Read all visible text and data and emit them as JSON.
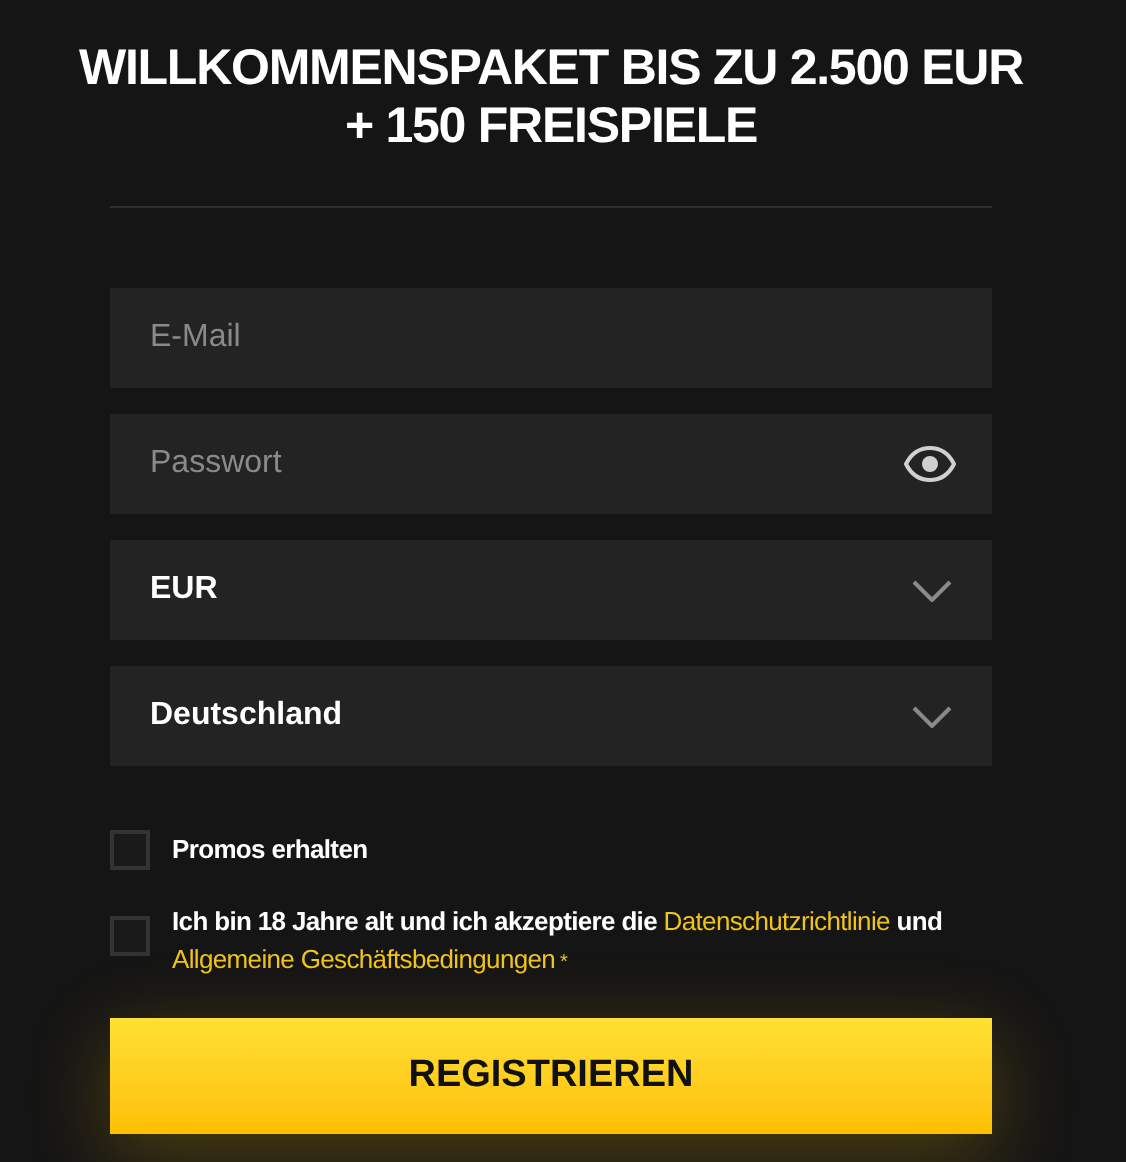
{
  "heading": "WILLKOMMENSPAKET BIS ZU 2.500 EUR + 150 FREISPIELE",
  "fields": [
    {
      "kind": "text",
      "placeholder": "E-Mail"
    },
    {
      "kind": "password",
      "placeholder": "Passwort"
    },
    {
      "kind": "select",
      "value": "EUR"
    },
    {
      "kind": "select",
      "value": "Deutschland"
    }
  ],
  "checkboxes": [
    {
      "kind": "plain",
      "checked": false,
      "label": "Promos erhalten"
    },
    {
      "kind": "consent",
      "checked": false,
      "label": "Ich bin 18 Jahre alt und ich akzeptiere die",
      "link_1": "Datenschutzrichtlinie",
      "middle": "und",
      "link_2": "Allgemeine Geschäftsbedingungen",
      "required_mark": "*"
    }
  ],
  "submit": "REGISTRIEREN"
}
